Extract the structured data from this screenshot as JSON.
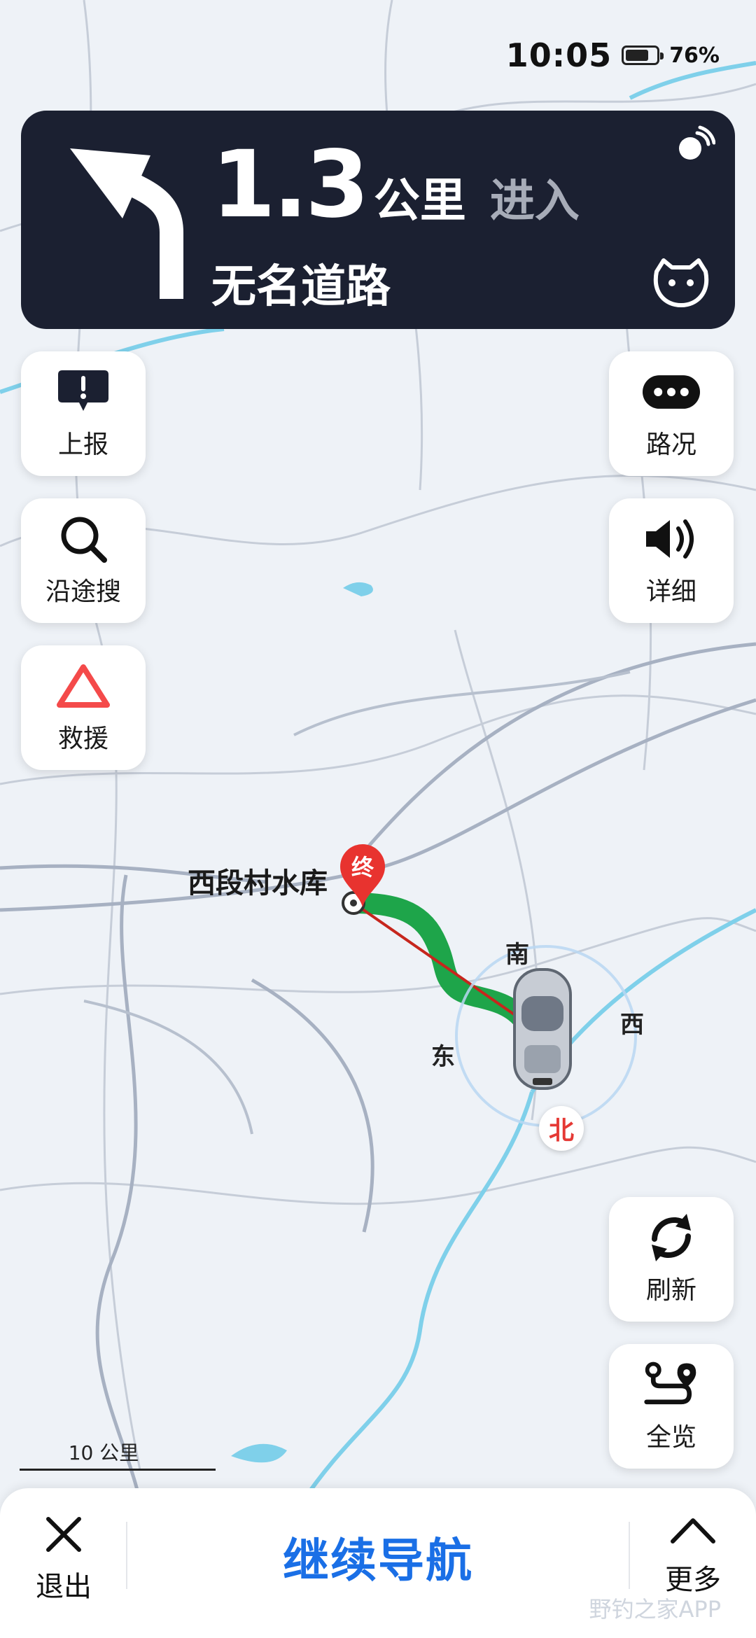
{
  "status": {
    "time": "10:05",
    "battery": "76%",
    "battery_level": 0.76
  },
  "nav": {
    "distance": "1.3",
    "unit": "公里",
    "action": "进入",
    "road": "无名道路"
  },
  "left_buttons": {
    "report": "上报",
    "search_along": "沿途搜",
    "rescue": "救援"
  },
  "right_buttons": {
    "traffic": "路况",
    "detail": "详细",
    "refresh": "刷新",
    "overview": "全览"
  },
  "map": {
    "destination": "西段村水库",
    "end_marker": "终",
    "compass": {
      "south": "南",
      "west": "西",
      "east": "东",
      "north": "北"
    },
    "scale": "10 公里",
    "route_color": "#1ea54a",
    "water_color": "#7fd0ea"
  },
  "bottom": {
    "exit": "退出",
    "continue": "继续导航",
    "more": "更多"
  },
  "watermark": "野钓之家APP"
}
